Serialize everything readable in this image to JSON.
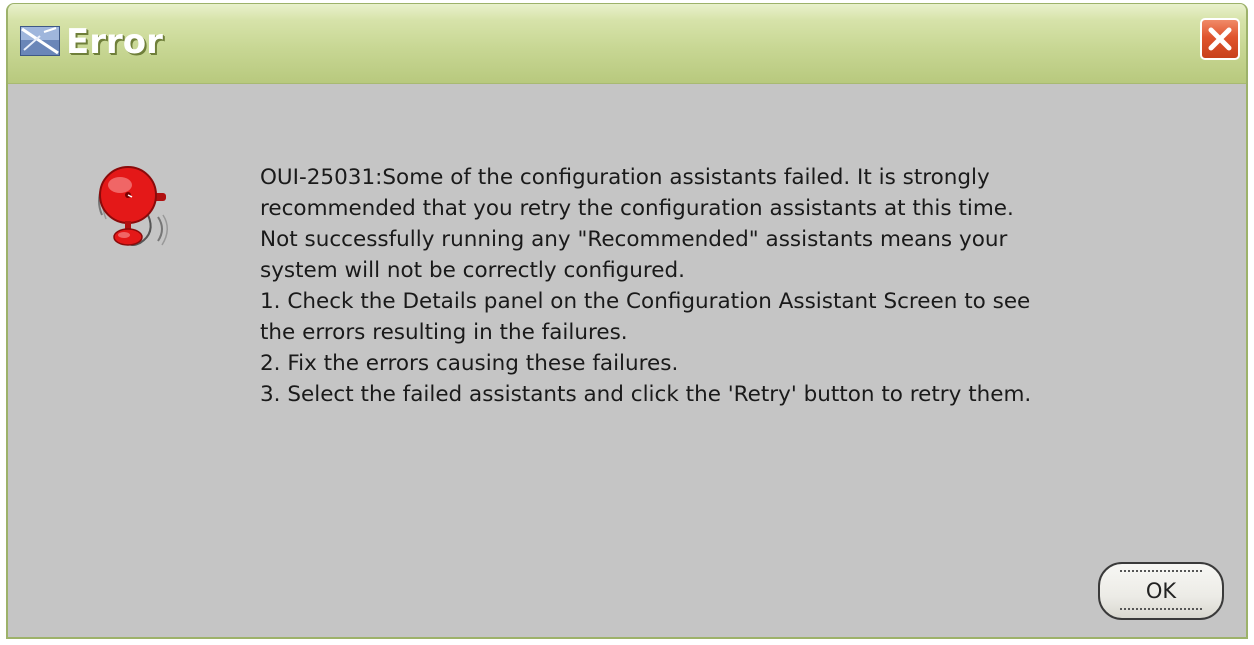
{
  "window": {
    "title": "Error",
    "title_icon": "java-app-icon",
    "close_icon": "close-icon"
  },
  "message": {
    "icon": "alarm-bell-icon",
    "lines": [
      "OUI-25031:Some of the configuration assistants failed. It is strongly",
      "recommended that you retry the configuration assistants at this time.",
      "Not successfully running any \"Recommended\" assistants means your",
      "system will not be correctly configured.",
      "1. Check the Details panel on the Configuration Assistant Screen to see",
      "the errors resulting in the failures.",
      "2. Fix the errors causing these failures.",
      "3. Select the failed assistants and click the 'Retry' button to retry them."
    ]
  },
  "buttons": {
    "ok_label": "OK"
  },
  "colors": {
    "titlebar": "#c8d794",
    "body": "#c5c5c5",
    "close_button": "#e0542e",
    "bell": "#e01010"
  }
}
